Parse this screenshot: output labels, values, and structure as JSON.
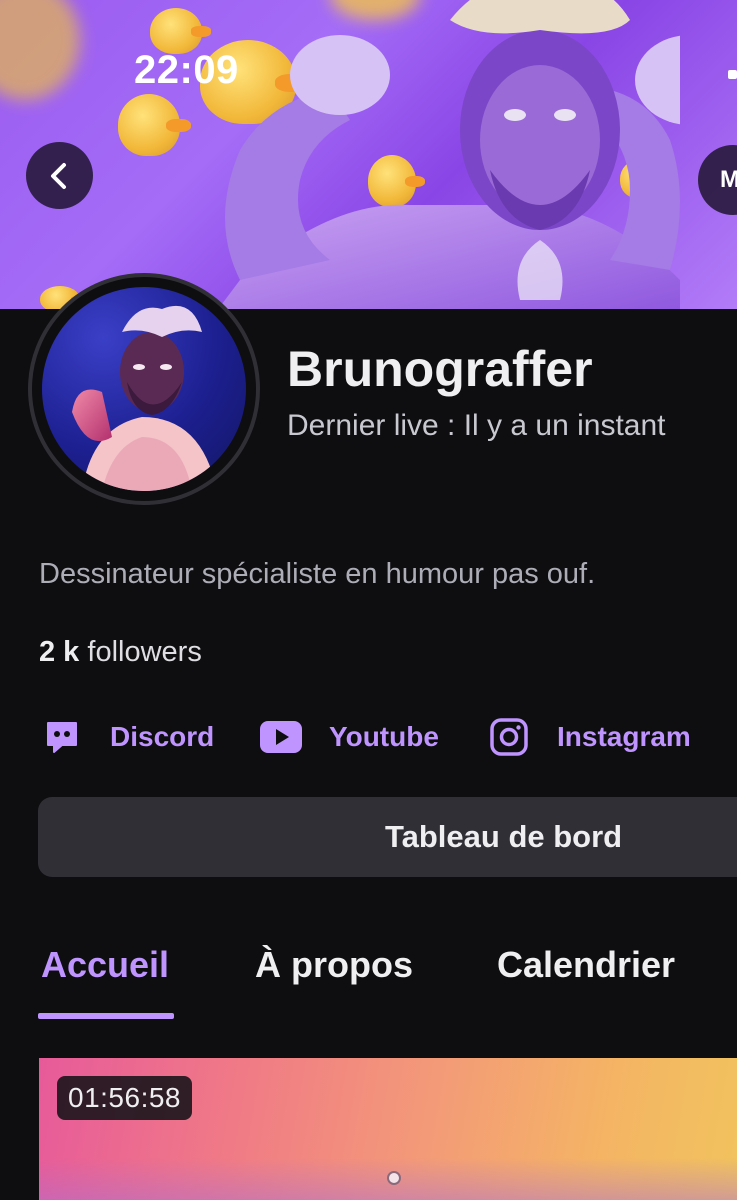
{
  "status_bar": {
    "time": "22:09"
  },
  "header": {
    "more_button_glyph": "M"
  },
  "channel": {
    "name": "Brunograffer",
    "last_live": "Dernier live : Il y a un instant",
    "bio": "Dessinateur spécialiste en humour pas ouf.",
    "followers_count": "2 k",
    "followers_label": "followers"
  },
  "socials": [
    {
      "label": "Discord",
      "icon": "discord-icon"
    },
    {
      "label": "Youtube",
      "icon": "youtube-icon"
    },
    {
      "label": "Instagram",
      "icon": "instagram-icon"
    }
  ],
  "dashboard_button": "Tableau de bord",
  "tabs": [
    {
      "label": "Accueil",
      "active": true
    },
    {
      "label": "À propos",
      "active": false
    },
    {
      "label": "Calendrier",
      "active": false
    }
  ],
  "video": {
    "duration": "01:56:58"
  },
  "colors": {
    "accent": "#bf94ff",
    "background": "#0e0e10",
    "button_bg": "#2f2f35"
  }
}
